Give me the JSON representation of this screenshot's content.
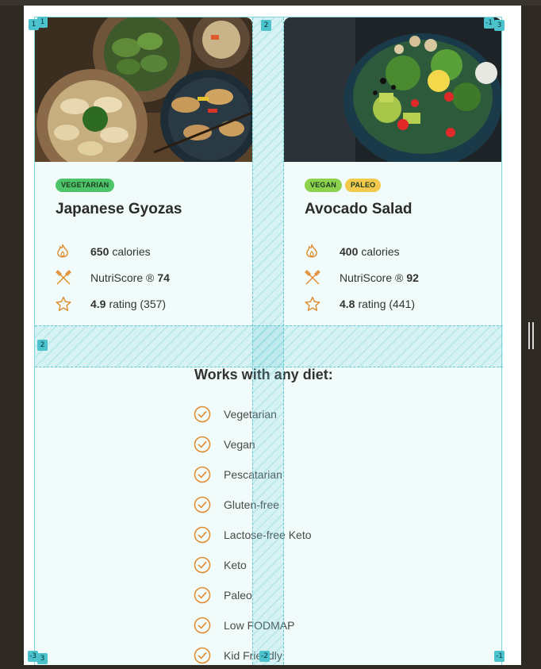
{
  "cards": [
    {
      "title": "Japanese Gyozas",
      "badges": [
        "VEGETARIAN"
      ],
      "calories_value": "650",
      "calories_label": "calories",
      "nutri_label": "NutriScore ®",
      "nutri_value": "74",
      "rating_value": "4.9",
      "rating_label": "rating (357)"
    },
    {
      "title": "Avocado Salad",
      "badges": [
        "VEGAN",
        "PALEO"
      ],
      "calories_value": "400",
      "calories_label": "calories",
      "nutri_label": "NutriScore ®",
      "nutri_value": "92",
      "rating_value": "4.8",
      "rating_label": "rating (441)"
    }
  ],
  "diet": {
    "title": "Works with any diet:",
    "items": [
      "Vegetarian",
      "Vegan",
      "Pescatarian",
      "Gluten-free",
      "Lactose-free Keto",
      "Keto",
      "Paleo",
      "Low FODMAP",
      "Kid Friendly"
    ]
  },
  "grid_overlay": {
    "labels": {
      "col_start_top": "1",
      "col_start_top_outer": "1",
      "col_mid_top": "2",
      "col_end_top": "-1",
      "col_end_top_outer": "3",
      "row_mid": "2",
      "col_start_bottom": "-3",
      "col_start_bottom_outer": "3",
      "col_mid_bottom": "-2",
      "col_end_bottom": "-1"
    }
  },
  "colors": {
    "accent": "#e08a2c",
    "grid_line": "#5fc8d0",
    "card_bg": "#f0fbfa"
  },
  "icons": [
    "flame-icon",
    "utensils-icon",
    "star-icon",
    "check-circle-icon"
  ]
}
